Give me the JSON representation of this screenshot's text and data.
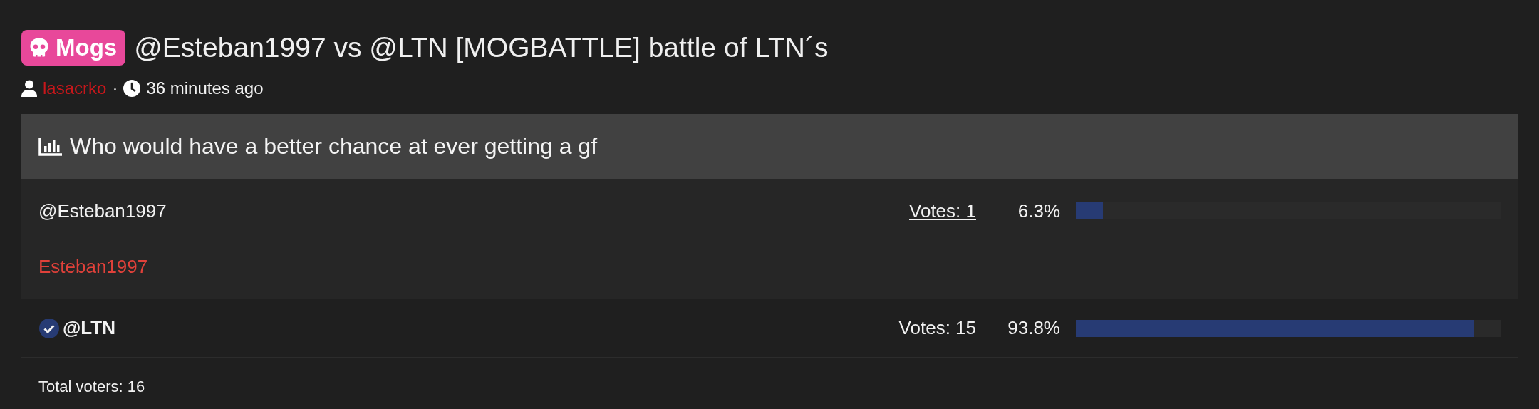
{
  "thread": {
    "prefix": "Mogs",
    "title": "@Esteban1997 vs @LTN [MOGBATTLE] battle of LTN´s",
    "author": "lasacrko",
    "separator": "·",
    "time": "36 minutes ago"
  },
  "poll": {
    "question": "Who would have a better chance at ever getting a gf",
    "options": [
      {
        "label": "@Esteban1997",
        "verified": false,
        "expanded": true,
        "votes": "Votes: 1",
        "percent": "6.3%",
        "level": 0.063,
        "voters": [
          "Esteban1997"
        ]
      },
      {
        "label": "@LTN",
        "verified": true,
        "expanded": false,
        "votes": "Votes: 15",
        "percent": "93.8%",
        "level": 0.938
      }
    ],
    "total": "Total voters: 16"
  }
}
